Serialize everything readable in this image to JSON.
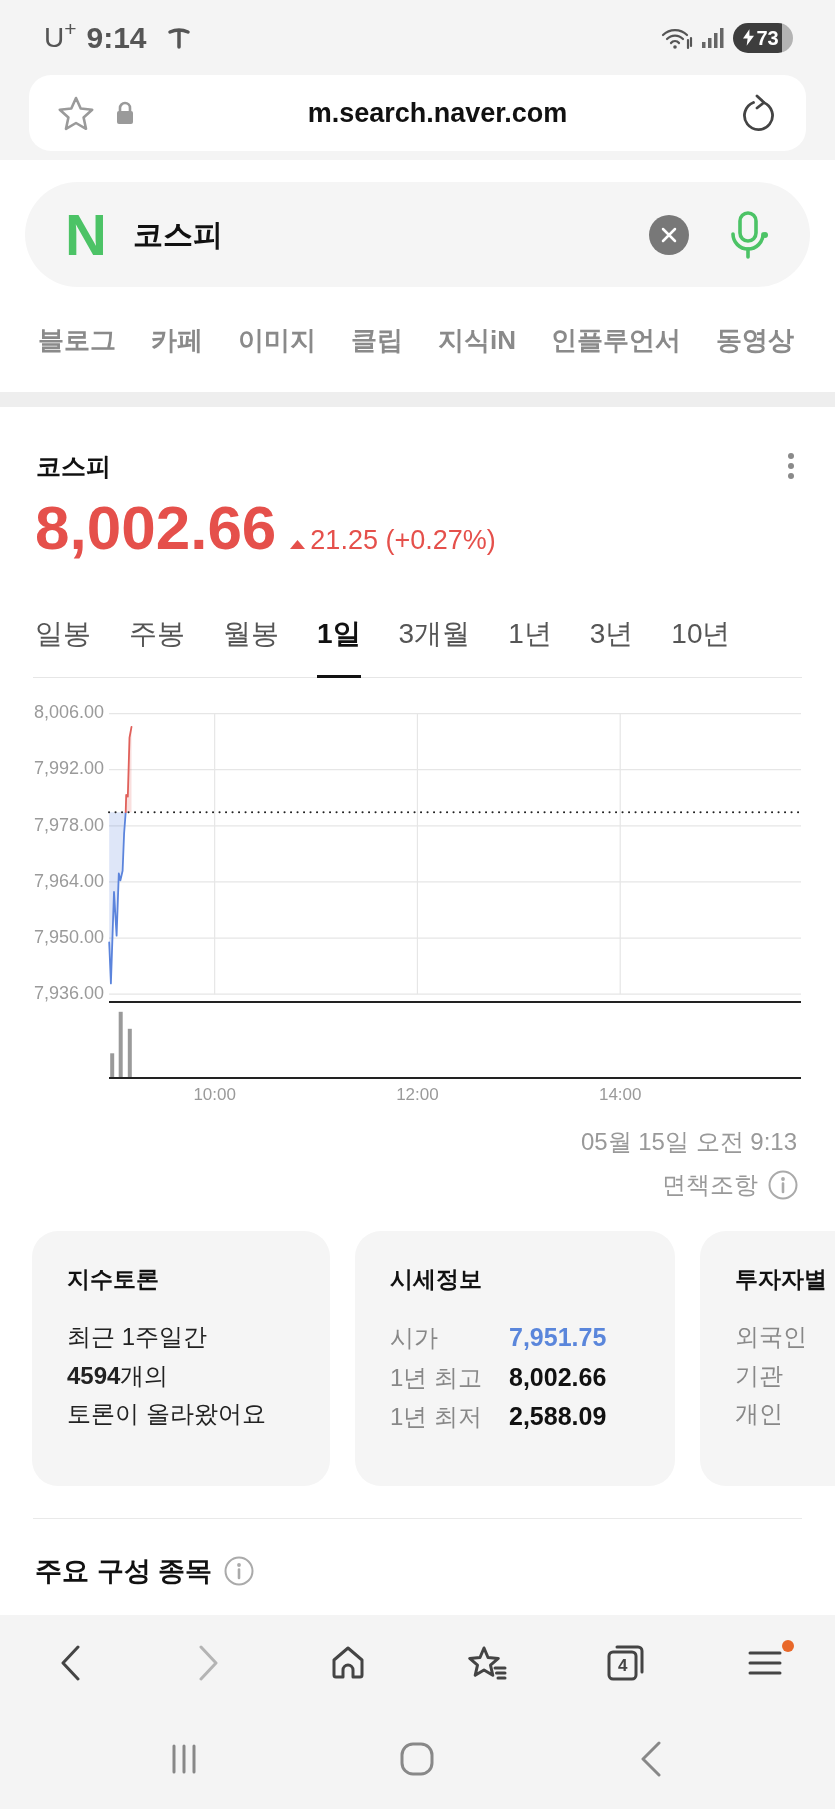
{
  "status_bar": {
    "carrier": "U$^{+}$",
    "time": "9:14",
    "battery": "73"
  },
  "address_bar": {
    "url": "m.search.naver.com"
  },
  "search": {
    "logo": "N",
    "query": "코스피"
  },
  "categories": [
    "블로그",
    "카페",
    "이미지",
    "클립",
    "지식iN",
    "인플루언서",
    "동영상"
  ],
  "index": {
    "name": "코스피",
    "price": "8,002.66",
    "rising": true,
    "change": "21.25 (+0.27%)"
  },
  "periods": [
    {
      "label": "일봉",
      "selected": false
    },
    {
      "label": "주봉",
      "selected": false
    },
    {
      "label": "월봉",
      "selected": false
    },
    {
      "label": "1일",
      "selected": true
    },
    {
      "label": "3개월",
      "selected": false
    },
    {
      "label": "1년",
      "selected": false
    },
    {
      "label": "3년",
      "selected": false
    },
    {
      "label": "10년",
      "selected": false
    }
  ],
  "chart": {
    "chart_data": {
      "type": "line",
      "grid": true,
      "x": [
        8.96,
        8.977,
        9.007,
        9.033,
        9.055,
        9.07,
        9.092,
        9.107,
        9.123,
        9.128,
        9.143,
        9.16,
        9.18
      ],
      "series": [
        {
          "color": "#5b84dc",
          "values": [
            7948.9,
            7938.7,
            7961.5,
            7950.6,
            7966.1,
            7964.4,
            7966.8,
            7976.1,
            7981.4,
            null,
            null,
            null,
            null
          ]
        },
        {
          "color": "#e0605a",
          "values": [
            null,
            null,
            null,
            null,
            null,
            null,
            null,
            null,
            7981.4,
            7985.7,
            7985.3,
            8000.0,
            8002.7
          ]
        }
      ],
      "xlim": [
        8.958,
        15.783
      ],
      "ylim": [
        7936,
        8006
      ],
      "xticks": [
        {
          "value": 10,
          "label": "10:00"
        },
        {
          "value": 12,
          "label": "12:00"
        },
        {
          "value": 14,
          "label": "14:00"
        }
      ],
      "yticks": [
        {
          "value": 7936,
          "label": "7,936.00"
        },
        {
          "value": 7950,
          "label": "7,950.00"
        },
        {
          "value": 7964,
          "label": "7,964.00"
        },
        {
          "value": 7978,
          "label": "7,978.00"
        },
        {
          "value": 7992,
          "label": "7,992.00"
        },
        {
          "value": 8006,
          "label": "8,006.00"
        }
      ],
      "ref_lines": [
        {
          "axis": "y",
          "value": 7981.41
        }
      ]
    }
  },
  "updated": "05월 15일 오전 9:13",
  "disclaimer": "면책조항",
  "cards": [
    {
      "kind": "text",
      "title": "지수토론",
      "text": "최근 1주일간\n**4594**개의\n토론이 올라왔어요"
    },
    {
      "kind": "rows",
      "title": "시세정보",
      "rows": [
        {
          "label": "시가",
          "value": "7,951.75",
          "color": "#5a86db"
        },
        {
          "label": "1년 최고",
          "value": "8,002.66",
          "color": "#111111"
        },
        {
          "label": "1년 최저",
          "value": "2,588.09",
          "color": "#111111"
        }
      ]
    },
    {
      "kind": "rows",
      "title": "투자자별",
      "rows": [
        {
          "label": "외국인"
        },
        {
          "label": "기관"
        },
        {
          "label": "개인"
        }
      ]
    }
  ],
  "section_title": "주요 구성 종목",
  "toolbar": [
    {
      "kind": "back",
      "disabled": false,
      "badge": false
    },
    {
      "kind": "forward",
      "disabled": true,
      "badge": false
    },
    {
      "kind": "home",
      "disabled": false,
      "badge": false
    },
    {
      "kind": "bookmarks",
      "disabled": false,
      "badge": false
    },
    {
      "kind": "tabs",
      "disabled": false,
      "badge": false,
      "count": "4"
    },
    {
      "kind": "menu",
      "disabled": false,
      "badge": true
    }
  ]
}
